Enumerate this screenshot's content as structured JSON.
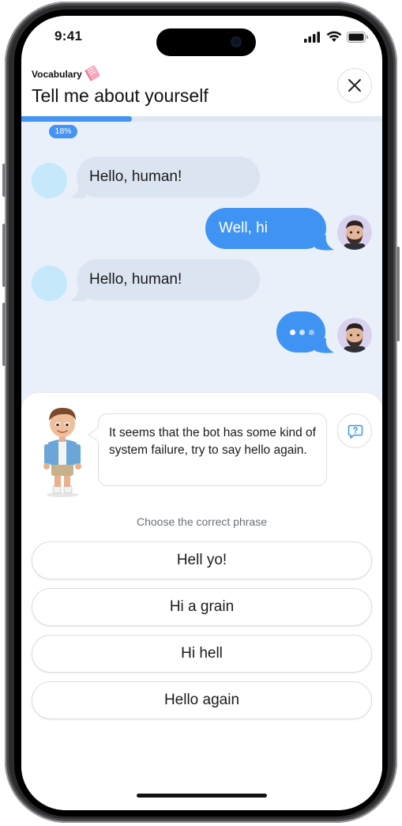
{
  "status_bar": {
    "time": "9:41"
  },
  "header": {
    "tag": "Vocabulary",
    "title": "Tell me about yourself",
    "close_icon": "close-icon"
  },
  "progress": {
    "value": 0.18,
    "label": "18%"
  },
  "messages": [
    {
      "sender": "bot",
      "text": "Hello, human!"
    },
    {
      "sender": "user",
      "text": "Well, hi"
    },
    {
      "sender": "bot",
      "text": "Hello, human!"
    },
    {
      "sender": "user",
      "typing": true
    }
  ],
  "tutor": {
    "message": "It seems that the bot has some kind of system failure, try to say hello again.",
    "help_icon": "help-chat-icon"
  },
  "choose_label": "Choose the correct phrase",
  "options": [
    "Hell yo!",
    "Hi a grain",
    "Hi hell",
    "Hello again"
  ],
  "colors": {
    "accent": "#3f93f2",
    "bot_bubble": "#dbe4f1",
    "chat_background": "#eaf0fa",
    "bot_avatar": "#c5e9fa",
    "user_avatar_bg": "#d9d2ee"
  }
}
